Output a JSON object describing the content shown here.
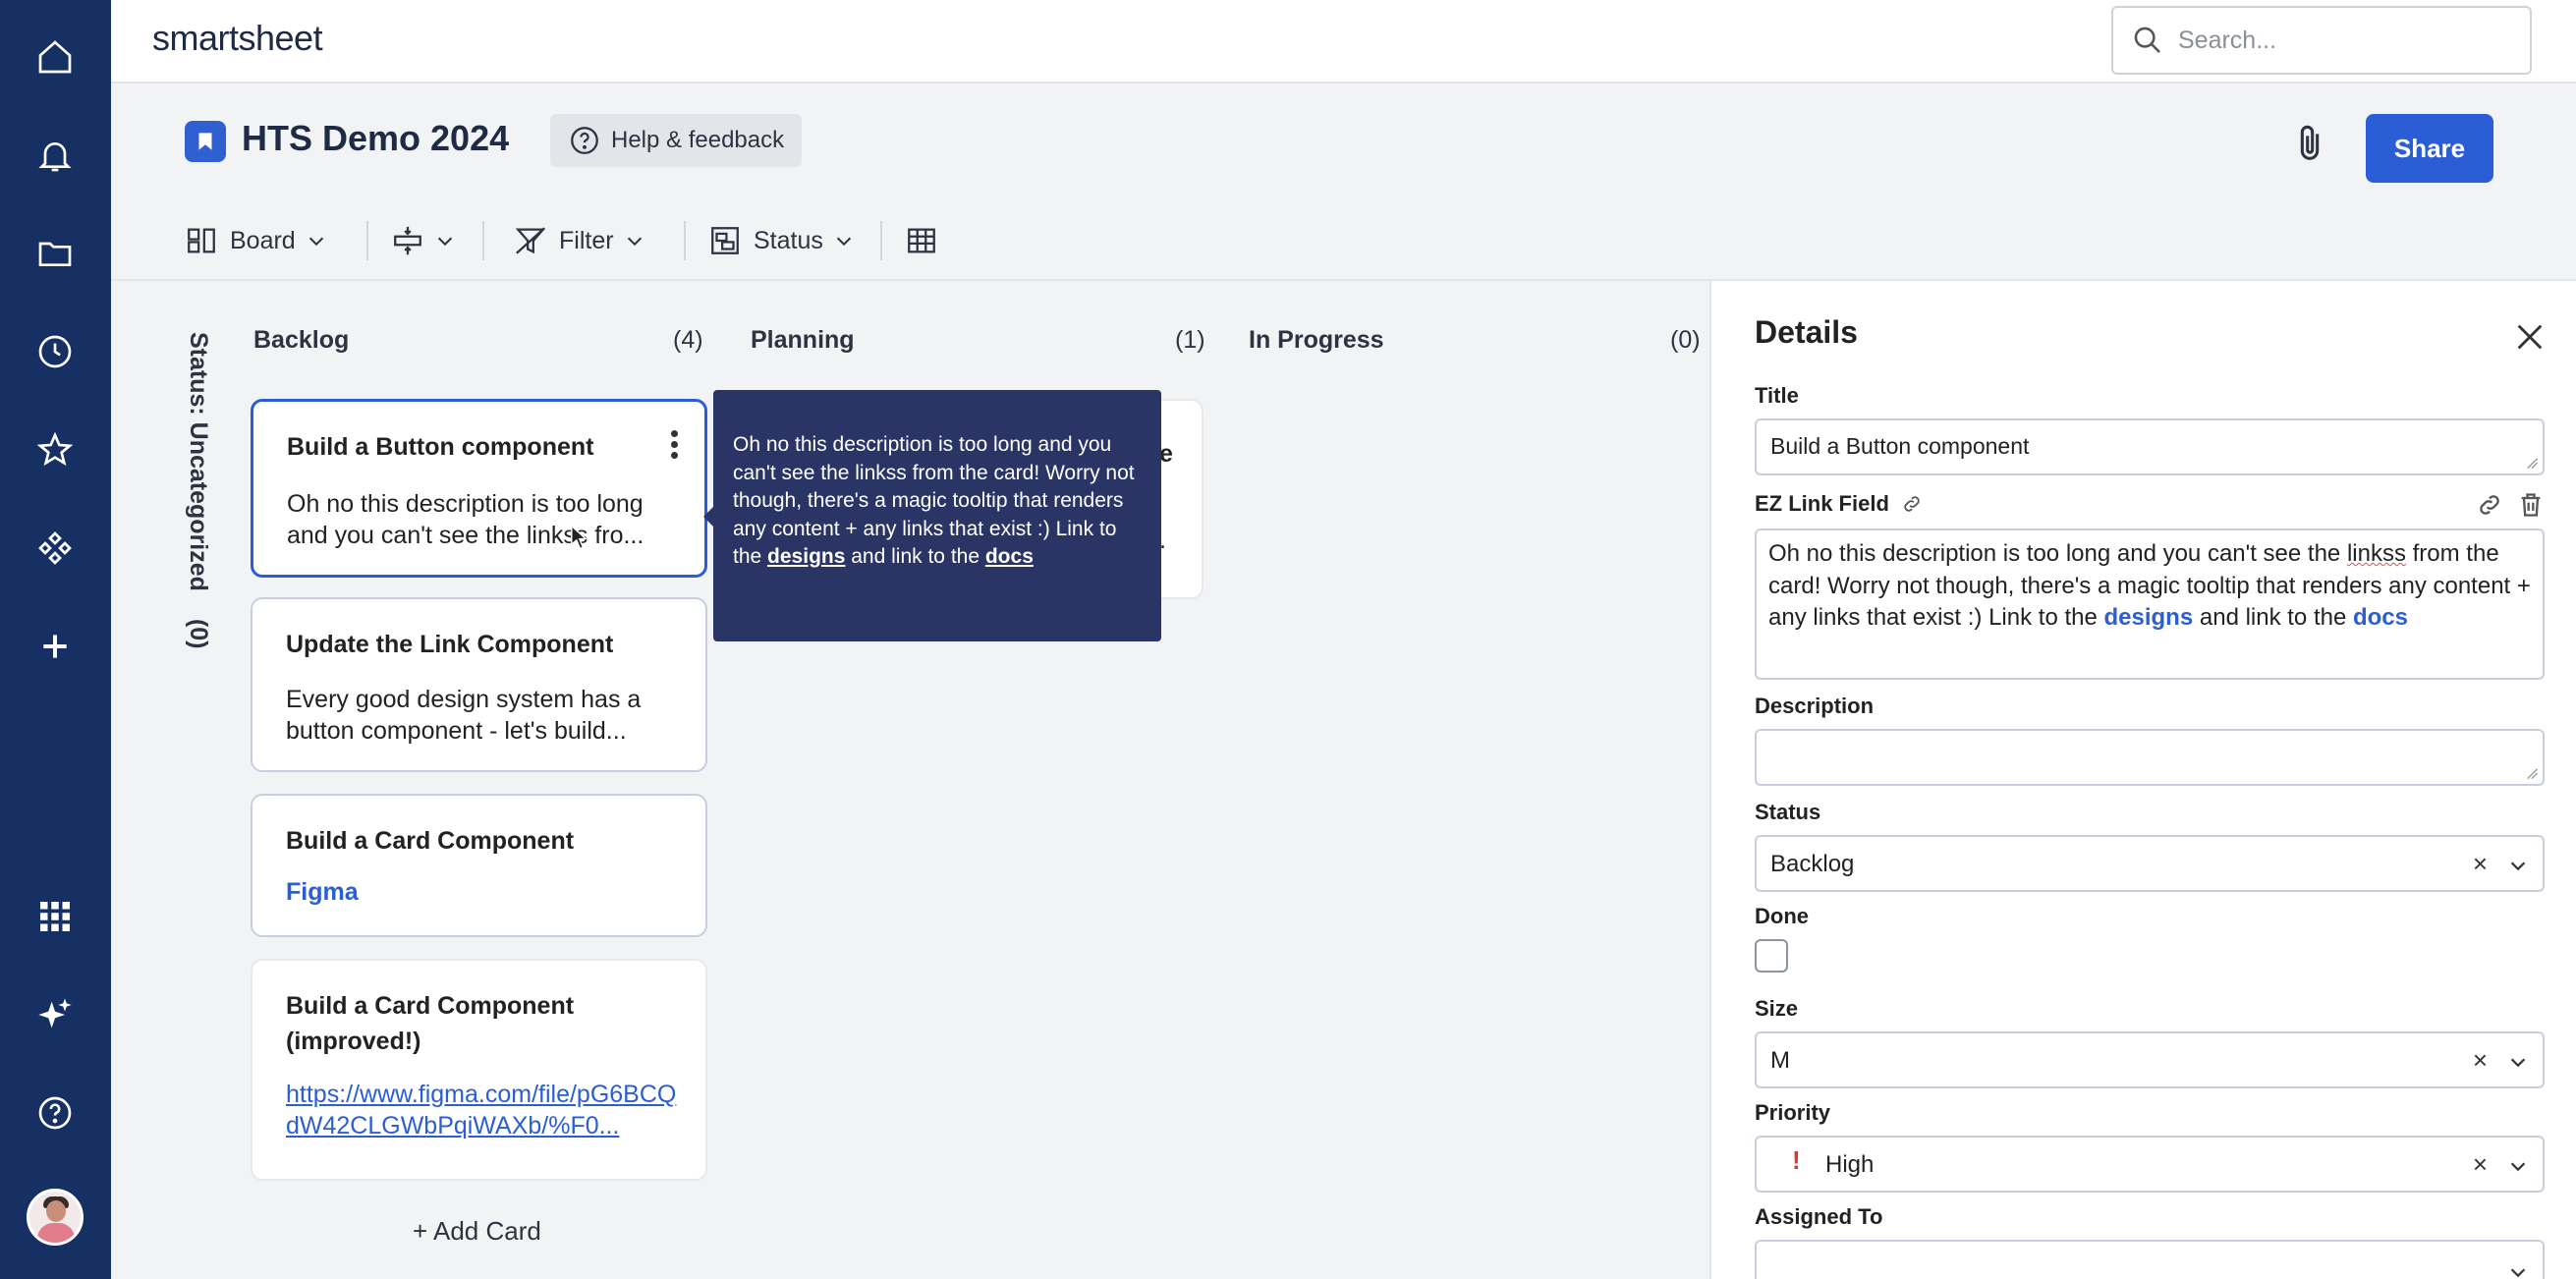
{
  "app": {
    "logo": "smartsheet"
  },
  "search": {
    "placeholder": "Search..."
  },
  "sheet": {
    "title": "HTS Demo 2024"
  },
  "header": {
    "help_label": "Help & feedback",
    "share_label": "Share"
  },
  "toolbar": {
    "board_label": "Board",
    "filter_label": "Filter",
    "status_label": "Status"
  },
  "board": {
    "swimlane_label": "Status: Uncategorized",
    "swimlane_count": "(0)",
    "columns": [
      {
        "name": "Backlog",
        "count": "(4)"
      },
      {
        "name": "Planning",
        "count": "(1)"
      },
      {
        "name": "In Progress",
        "count": "(0)"
      }
    ],
    "cards": [
      {
        "title": "Build a Button component",
        "desc": "Oh no this description is too long and you can't see the linkss fro..."
      },
      {
        "title": "Update the Link Component",
        "desc": "Every good design system has a button component - let's build..."
      },
      {
        "title": "Build a Card Component",
        "link": "Figma"
      },
      {
        "title": "Build a Card Component (improved!)",
        "link": "https://www.figma.com/file/pG6BCQdW42CLGWbPqiWAXb/%F0..."
      }
    ],
    "planning_card_fragments": {
      "right_char": "e",
      "dots": "."
    },
    "add_card_label": "+ Add Card"
  },
  "tooltip": {
    "text": "Oh no this description is too long and you can't see the linkss from the card! Worry not though, there's a magic tooltip that renders any content + any links that exist :) Link to the",
    "link1": "designs",
    "mid": "and link to the",
    "link2": "docs"
  },
  "details": {
    "heading": "Details",
    "title_label": "Title",
    "title_value": "Build a Button component",
    "ez_label": "EZ Link Field",
    "ez_text_before": "Oh no this description is too long and you can't see the",
    "ez_spell_word": "linkss",
    "ez_text_after": "from the card! Worry not though, there's a magic tooltip that renders any content + any links that exist :)  Link to the",
    "ez_link1": "designs",
    "ez_mid": "and link to the",
    "ez_link2": "docs",
    "description_label": "Description",
    "description_value": "",
    "status_label": "Status",
    "status_value": "Backlog",
    "done_label": "Done",
    "done_checked": false,
    "size_label": "Size",
    "size_value": "M",
    "priority_label": "Priority",
    "priority_mark": "!",
    "priority_value": "High",
    "assigned_label": "Assigned To",
    "clear_glyph": "×"
  },
  "colors": {
    "rail": "#163064",
    "accent": "#2b5ed6",
    "tooltip": "#2a3566"
  }
}
